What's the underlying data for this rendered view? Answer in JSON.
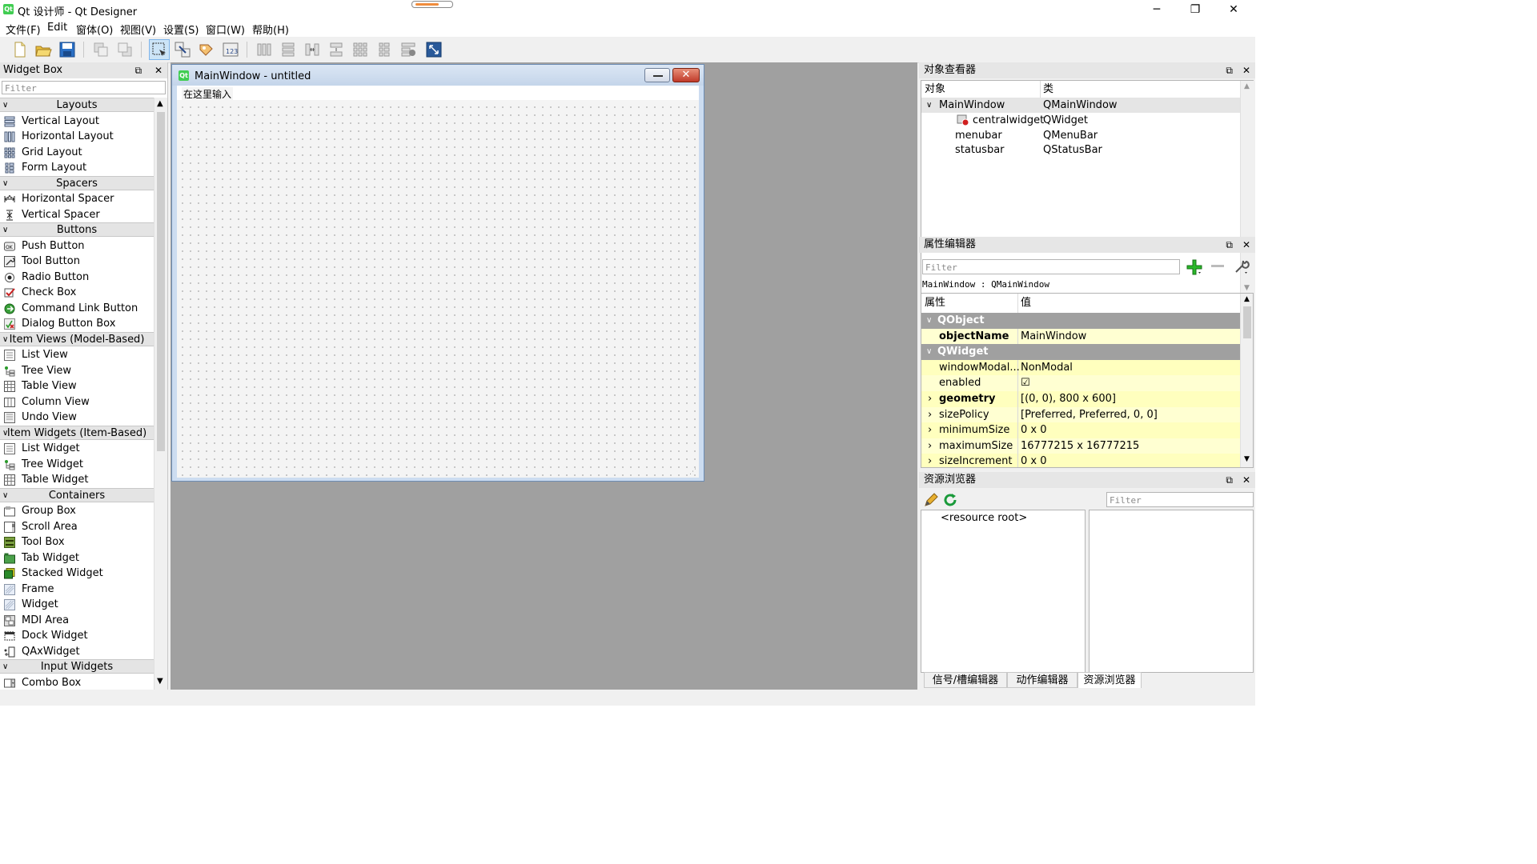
{
  "window": {
    "title": "Qt 设计师 - Qt Designer",
    "logo": "Qt",
    "minimize": "─",
    "restore": "❐",
    "close": "✕",
    "progress_pct": 64
  },
  "menubar": {
    "items": [
      "文件(F)",
      "Edit",
      "窗体(O)",
      "视图(V)",
      "设置(S)",
      "窗口(W)",
      "帮助(H)"
    ]
  },
  "toolbar": {
    "icons": [
      "new-file-icon",
      "open-folder-icon",
      "save-icon",
      "send-to-back-icon",
      "bring-to-front-icon",
      "edit-widgets-icon",
      "edit-signals-slots-icon",
      "edit-buddies-icon",
      "edit-tab-order-icon",
      "layout-horizontal-icon",
      "layout-vertical-icon",
      "layout-horizontal-splitter-icon",
      "layout-vertical-splitter-icon",
      "layout-grid-icon",
      "layout-form-icon",
      "break-layout-icon",
      "adjust-size-icon"
    ]
  },
  "widget_box": {
    "title": "Widget Box",
    "filter_placeholder": "Filter",
    "float_icon": "⧉",
    "close_icon": "✕",
    "rows": [
      {
        "kind": "cat",
        "label": "Layouts"
      },
      {
        "kind": "item",
        "label": "Vertical Layout",
        "icon": "vertical-layout-icon"
      },
      {
        "kind": "item",
        "label": "Horizontal Layout",
        "icon": "horizontal-layout-icon"
      },
      {
        "kind": "item",
        "label": "Grid Layout",
        "icon": "grid-layout-icon"
      },
      {
        "kind": "item",
        "label": "Form Layout",
        "icon": "form-layout-icon"
      },
      {
        "kind": "cat",
        "label": "Spacers"
      },
      {
        "kind": "item",
        "label": "Horizontal Spacer",
        "icon": "horizontal-spacer-icon"
      },
      {
        "kind": "item",
        "label": "Vertical Spacer",
        "icon": "vertical-spacer-icon"
      },
      {
        "kind": "cat",
        "label": "Buttons"
      },
      {
        "kind": "item",
        "label": "Push Button",
        "icon": "push-button-icon"
      },
      {
        "kind": "item",
        "label": "Tool Button",
        "icon": "tool-button-icon"
      },
      {
        "kind": "item",
        "label": "Radio Button",
        "icon": "radio-button-icon"
      },
      {
        "kind": "item",
        "label": "Check Box",
        "icon": "check-box-icon"
      },
      {
        "kind": "item",
        "label": "Command Link Button",
        "icon": "command-link-icon"
      },
      {
        "kind": "item",
        "label": "Dialog Button Box",
        "icon": "dialog-button-box-icon"
      },
      {
        "kind": "cat",
        "label": "Item Views (Model-Based)"
      },
      {
        "kind": "item",
        "label": "List View",
        "icon": "list-view-icon"
      },
      {
        "kind": "item",
        "label": "Tree View",
        "icon": "tree-view-icon"
      },
      {
        "kind": "item",
        "label": "Table View",
        "icon": "table-view-icon"
      },
      {
        "kind": "item",
        "label": "Column View",
        "icon": "column-view-icon"
      },
      {
        "kind": "item",
        "label": "Undo View",
        "icon": "undo-view-icon"
      },
      {
        "kind": "cat",
        "label": "Item Widgets (Item-Based)"
      },
      {
        "kind": "item",
        "label": "List Widget",
        "icon": "list-widget-icon"
      },
      {
        "kind": "item",
        "label": "Tree Widget",
        "icon": "tree-widget-icon"
      },
      {
        "kind": "item",
        "label": "Table Widget",
        "icon": "table-widget-icon"
      },
      {
        "kind": "cat",
        "label": "Containers"
      },
      {
        "kind": "item",
        "label": "Group Box",
        "icon": "group-box-icon"
      },
      {
        "kind": "item",
        "label": "Scroll Area",
        "icon": "scroll-area-icon"
      },
      {
        "kind": "item",
        "label": "Tool Box",
        "icon": "tool-box-icon"
      },
      {
        "kind": "item",
        "label": "Tab Widget",
        "icon": "tab-widget-icon"
      },
      {
        "kind": "item",
        "label": "Stacked Widget",
        "icon": "stacked-widget-icon"
      },
      {
        "kind": "item",
        "label": "Frame",
        "icon": "frame-icon"
      },
      {
        "kind": "item",
        "label": "Widget",
        "icon": "widget-icon"
      },
      {
        "kind": "item",
        "label": "MDI Area",
        "icon": "mdi-area-icon"
      },
      {
        "kind": "item",
        "label": "Dock Widget",
        "icon": "dock-widget-icon"
      },
      {
        "kind": "item",
        "label": "QAxWidget",
        "icon": "qaxwidget-icon"
      },
      {
        "kind": "cat",
        "label": "Input Widgets"
      },
      {
        "kind": "item",
        "label": "Combo Box",
        "icon": "combo-box-icon"
      }
    ]
  },
  "form_window": {
    "title": "MainWindow - untitled",
    "logo": "Qt",
    "menubar_placeholder": "在这里输入"
  },
  "object_inspector": {
    "title": "对象查看器",
    "col_object": "对象",
    "col_class": "类",
    "rows": [
      {
        "object": "MainWindow",
        "class": "QMainWindow",
        "level": 0,
        "expanded": true,
        "selected": true
      },
      {
        "object": "centralwidget",
        "class": "QWidget",
        "level": 1,
        "icon": true
      },
      {
        "object": "menubar",
        "class": "QMenuBar",
        "level": 1
      },
      {
        "object": "statusbar",
        "class": "QStatusBar",
        "level": 1
      }
    ]
  },
  "property_editor": {
    "title": "属性编辑器",
    "filter_placeholder": "Filter",
    "context": "MainWindow : QMainWindow",
    "col_property": "属性",
    "col_value": "值",
    "rows": [
      {
        "kind": "group",
        "name": "QObject"
      },
      {
        "kind": "prop",
        "name": "objectName",
        "value": "MainWindow",
        "bold": true,
        "shade": "y1"
      },
      {
        "kind": "group",
        "name": "QWidget"
      },
      {
        "kind": "prop",
        "name": "windowModal...",
        "value": "NonModal",
        "shade": "y2"
      },
      {
        "kind": "prop",
        "name": "enabled",
        "value": "☑",
        "shade": "y1"
      },
      {
        "kind": "prop",
        "name": "geometry",
        "value": "[(0, 0), 800 x 600]",
        "bold": true,
        "expand": true,
        "shade": "y2"
      },
      {
        "kind": "prop",
        "name": "sizePolicy",
        "value": "[Preferred, Preferred, 0, 0]",
        "expand": true,
        "shade": "y1"
      },
      {
        "kind": "prop",
        "name": "minimumSize",
        "value": "0 x 0",
        "expand": true,
        "shade": "y2"
      },
      {
        "kind": "prop",
        "name": "maximumSize",
        "value": "16777215 x 16777215",
        "expand": true,
        "shade": "y1"
      },
      {
        "kind": "prop",
        "name": "sizeIncrement",
        "value": "0 x 0",
        "expand": true,
        "shade": "y2"
      }
    ]
  },
  "resource_browser": {
    "title": "资源浏览器",
    "filter_placeholder": "Filter",
    "root_label": "<resource root>"
  },
  "tabs": [
    "信号/槽编辑器",
    "动作编辑器",
    "资源浏览器"
  ],
  "colors": {
    "accent": "#3c7ac8",
    "group_bg": "#a0a0a0",
    "yellow": "#ffffd2",
    "qt_green": "#41cd52"
  }
}
